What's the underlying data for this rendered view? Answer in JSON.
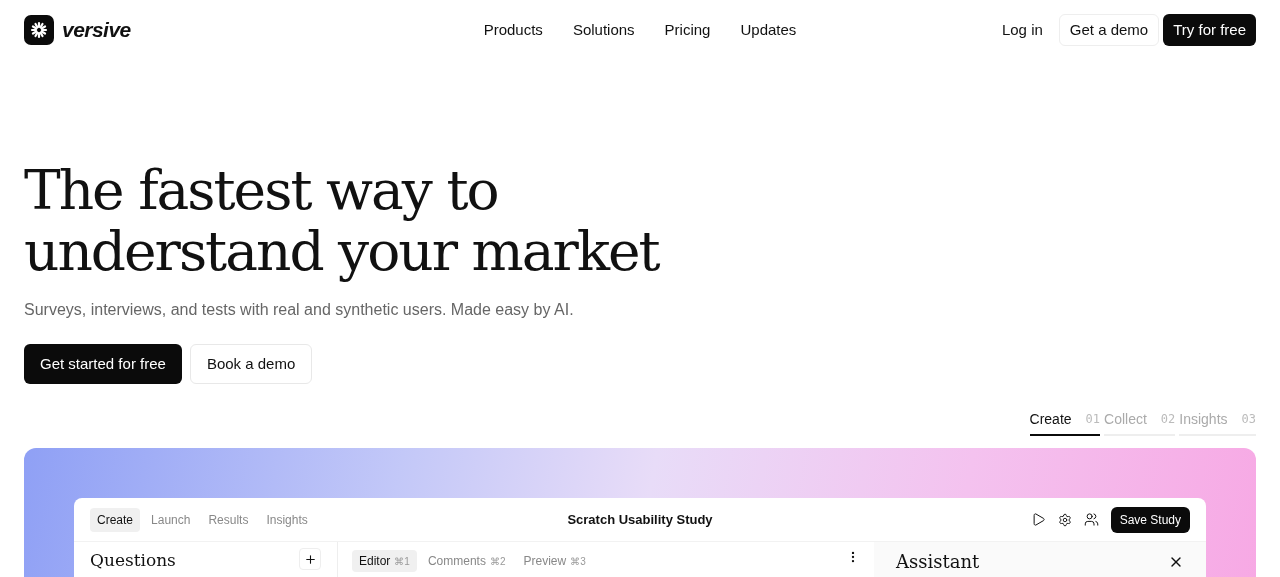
{
  "brand": "versive",
  "nav": {
    "links": [
      "Products",
      "Solutions",
      "Pricing",
      "Updates"
    ],
    "login": "Log in",
    "demo": "Get a demo",
    "try": "Try for free"
  },
  "hero": {
    "title_lines": [
      "The fastest way to",
      "understand your market"
    ],
    "subtitle": "Surveys, interviews, and tests with real and synthetic users. Made easy by AI.",
    "primary": "Get started for free",
    "secondary": "Book a demo"
  },
  "steps": [
    {
      "label": "Create",
      "number": "01",
      "selected": true
    },
    {
      "label": "Collect",
      "number": "02",
      "selected": false
    },
    {
      "label": "Insights",
      "number": "03",
      "selected": false
    }
  ],
  "app": {
    "tabs": [
      {
        "label": "Create",
        "selected": true
      },
      {
        "label": "Launch",
        "selected": false
      },
      {
        "label": "Results",
        "selected": false
      },
      {
        "label": "Insights",
        "selected": false
      }
    ],
    "title": "Scratch Usability Study",
    "save": "Save Study",
    "questions_heading": "Questions",
    "editor_tabs": [
      {
        "label": "Editor",
        "shortcut": "⌘1",
        "selected": true
      },
      {
        "label": "Comments",
        "shortcut": "⌘2",
        "selected": false
      },
      {
        "label": "Preview",
        "shortcut": "⌘3",
        "selected": false
      }
    ],
    "assistant_heading": "Assistant"
  }
}
